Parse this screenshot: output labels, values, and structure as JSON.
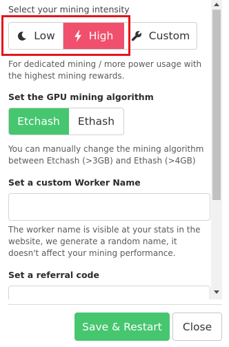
{
  "intensity": {
    "heading": "Select your mining intensity",
    "options": [
      {
        "label": "Low",
        "icon": "moon-icon"
      },
      {
        "label": "High",
        "icon": "lightning-bolt-icon"
      },
      {
        "label": "Custom",
        "icon": "wrench-icon"
      }
    ],
    "selected": "High",
    "description": "For dedicated mining / more power usage with the highest mining rewards."
  },
  "algorithm": {
    "heading": "Set the GPU mining algorithm",
    "options": [
      {
        "label": "Etchash"
      },
      {
        "label": "Ethash"
      }
    ],
    "selected": "Etchash",
    "description": "You can manually change the mining algorithm between Etchash (>3GB) and Ethash (>4GB)"
  },
  "worker": {
    "heading": "Set a custom Worker Name",
    "value": "",
    "description": "The worker name is visible at your stats in the website, we generate a random name, it doesn't affect your mining performance."
  },
  "referral": {
    "heading": "Set a referral code",
    "value": ""
  },
  "footer": {
    "save_label": "Save & Restart",
    "close_label": "Close"
  },
  "colors": {
    "accent_red": "#f0506e",
    "accent_green": "#46c66f",
    "highlight": "#e3141b"
  }
}
